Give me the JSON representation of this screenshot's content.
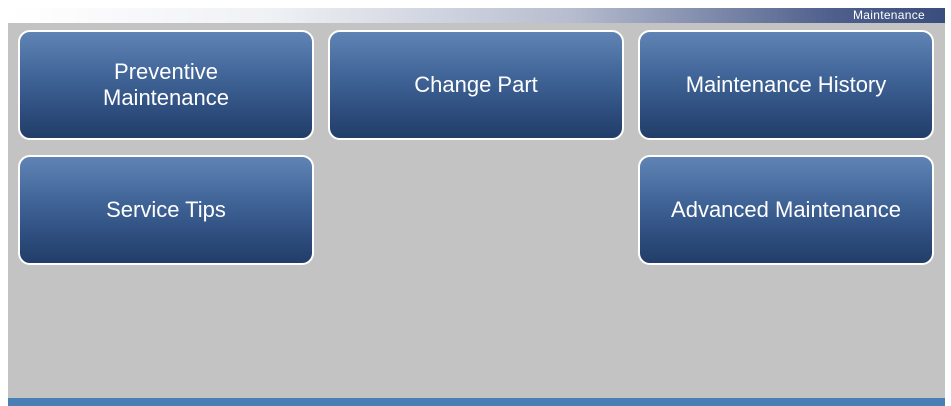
{
  "header": {
    "title": "Maintenance"
  },
  "menu": {
    "buttons": [
      {
        "label": "Preventive\nMaintenance"
      },
      {
        "label": "Change Part"
      },
      {
        "label": "Maintenance History"
      },
      {
        "label": "Service Tips"
      },
      {
        "label": "Advanced Maintenance"
      }
    ]
  },
  "colors": {
    "background": "#c3c3c3",
    "button_top": "#5f84b4",
    "button_bottom": "#223d68",
    "bottom_bar": "#4a7fb5"
  }
}
